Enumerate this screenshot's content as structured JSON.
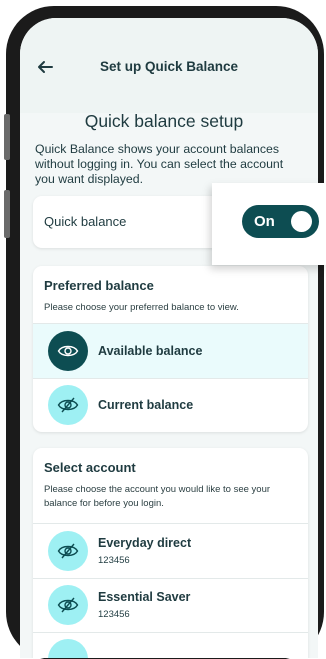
{
  "header": {
    "title": "Set up Quick Balance"
  },
  "page": {
    "title": "Quick balance setup",
    "intro": "Quick Balance shows your account balances without logging in. You can select the account you want displayed."
  },
  "quick_balance": {
    "label": "Quick balance",
    "toggle_label": "On",
    "toggle_state": "on"
  },
  "preferred_balance": {
    "title": "Preferred balance",
    "description": "Please choose your preferred balance to view.",
    "options": [
      {
        "label": "Available balance",
        "selected": true,
        "icon": "eye-icon"
      },
      {
        "label": "Current balance",
        "selected": false,
        "icon": "eye-slash-icon"
      }
    ]
  },
  "select_account": {
    "title": "Select account",
    "description": "Please choose the account you would like to see your balance for before you login.",
    "accounts": [
      {
        "name": "Everyday direct",
        "number": "123456",
        "icon": "eye-slash-icon"
      },
      {
        "name": "Essential Saver",
        "number": "123456",
        "icon": "eye-slash-icon"
      }
    ]
  },
  "colors": {
    "primary_dark": "#0d4d52",
    "accent_light": "#9ef0f3",
    "selected_row_bg": "#eafbfc",
    "text": "#1f3b40"
  }
}
